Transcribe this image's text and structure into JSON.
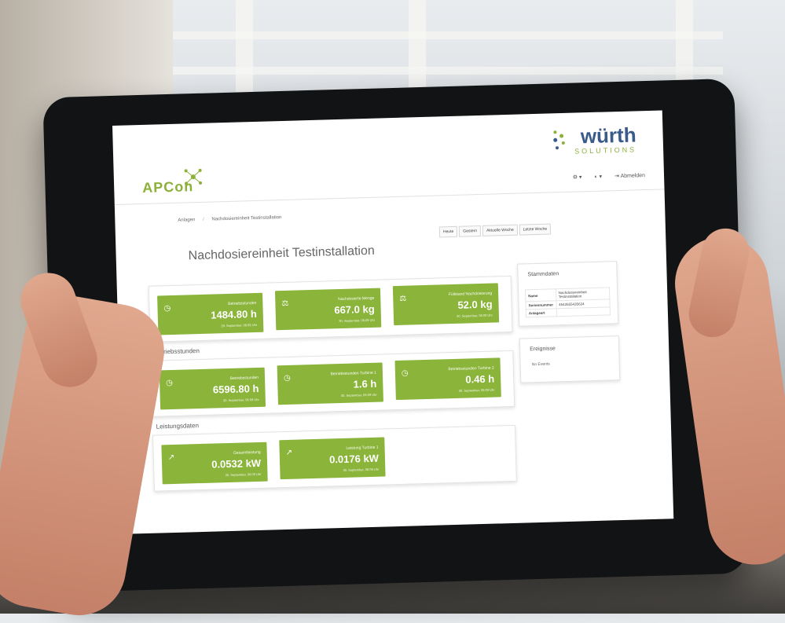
{
  "app": {
    "brand": "APCon",
    "company": "würth",
    "company_sub": "SOLUTIONS",
    "topnav": [
      "⚙ ▾",
      "◐ ▾",
      "⇥ Abmelden"
    ]
  },
  "breadcrumb": [
    "Anlagen",
    "Nachdosiereinheit Testinstallation"
  ],
  "range_tabs": [
    "Heute",
    "Gestern",
    "Aktuelle Woche",
    "Letzte Woche"
  ],
  "page_title": "Nachdosiereinheit Testinstallation",
  "sections": [
    {
      "title": "",
      "tiles": [
        {
          "icon": "clock-icon",
          "label": "Betriebsstunden",
          "value": "1484.80 h",
          "time": "29. September, 06:09 Uhr"
        },
        {
          "icon": "scale-icon",
          "label": "Nachdosierte Menge",
          "value": "667.0 kg",
          "time": "30. September, 06:09 Uhr"
        },
        {
          "icon": "scale-icon",
          "label": "Füllstand Nachdosierung",
          "value": "52.0 kg",
          "time": "30. September, 06:09 Uhr"
        }
      ]
    },
    {
      "title": "Betriebsstunden",
      "tiles": [
        {
          "icon": "clock-icon",
          "label": "Betriebsstunden",
          "value": "6596.80 h",
          "time": "30. September, 06:09 Uhr"
        },
        {
          "icon": "clock-icon",
          "label": "Betriebsstunden Turbine 1",
          "value": "1.6 h",
          "time": "30. September, 06:09 Uhr"
        },
        {
          "icon": "clock-icon",
          "label": "Betriebsstunden Turbine 2",
          "value": "0.46 h",
          "time": "30. September, 06:09 Uhr"
        }
      ]
    },
    {
      "title": "Leistungsdaten",
      "tiles": [
        {
          "icon": "chart-icon",
          "label": "Gesamtleistung",
          "value": "0.0532 kW",
          "time": "30. September, 06:09 Uhr"
        },
        {
          "icon": "chart-icon",
          "label": "Leistung Turbine 1",
          "value": "0.0176 kW",
          "time": "30. September, 06:09 Uhr"
        }
      ]
    }
  ],
  "stammdaten": {
    "title": "Stammdaten",
    "rows": [
      {
        "key": "Name",
        "value": "Nachdosiereinheit Testinstallation"
      },
      {
        "key": "Seriennummer",
        "value": "4643555435634"
      },
      {
        "key": "Anlageart",
        "value": ""
      }
    ]
  },
  "ereignisse": {
    "title": "Ereignisse",
    "text": "No Events"
  },
  "colors": {
    "tile_green": "#8ab43a",
    "brand_green": "#8cb13a",
    "wurth_blue": "#3a5b8a"
  }
}
